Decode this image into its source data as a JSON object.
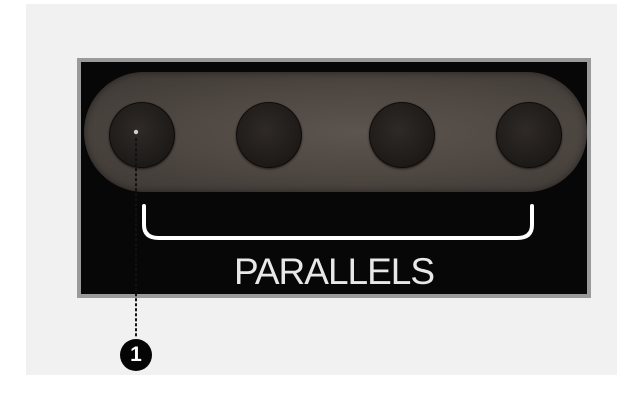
{
  "diagram": {
    "panel_label": "PARALLELS",
    "jacks": [
      {
        "id": "jack-1"
      },
      {
        "id": "jack-2"
      },
      {
        "id": "jack-3"
      },
      {
        "id": "jack-4"
      }
    ],
    "callout": {
      "number": "1",
      "target": "jack-1"
    }
  },
  "colors": {
    "background": "#f1f1f1",
    "panel_border": "#9a9a9a",
    "panel_face": "#070707",
    "pill": "#4f4843",
    "jack": "#211d1b",
    "label": "#e8e8e8",
    "callout": "#050505"
  },
  "icons": {
    "jack": "audio-jack-icon",
    "callout_badge": "numbered-callout-icon",
    "leader_line": "dotted-leader-line"
  }
}
